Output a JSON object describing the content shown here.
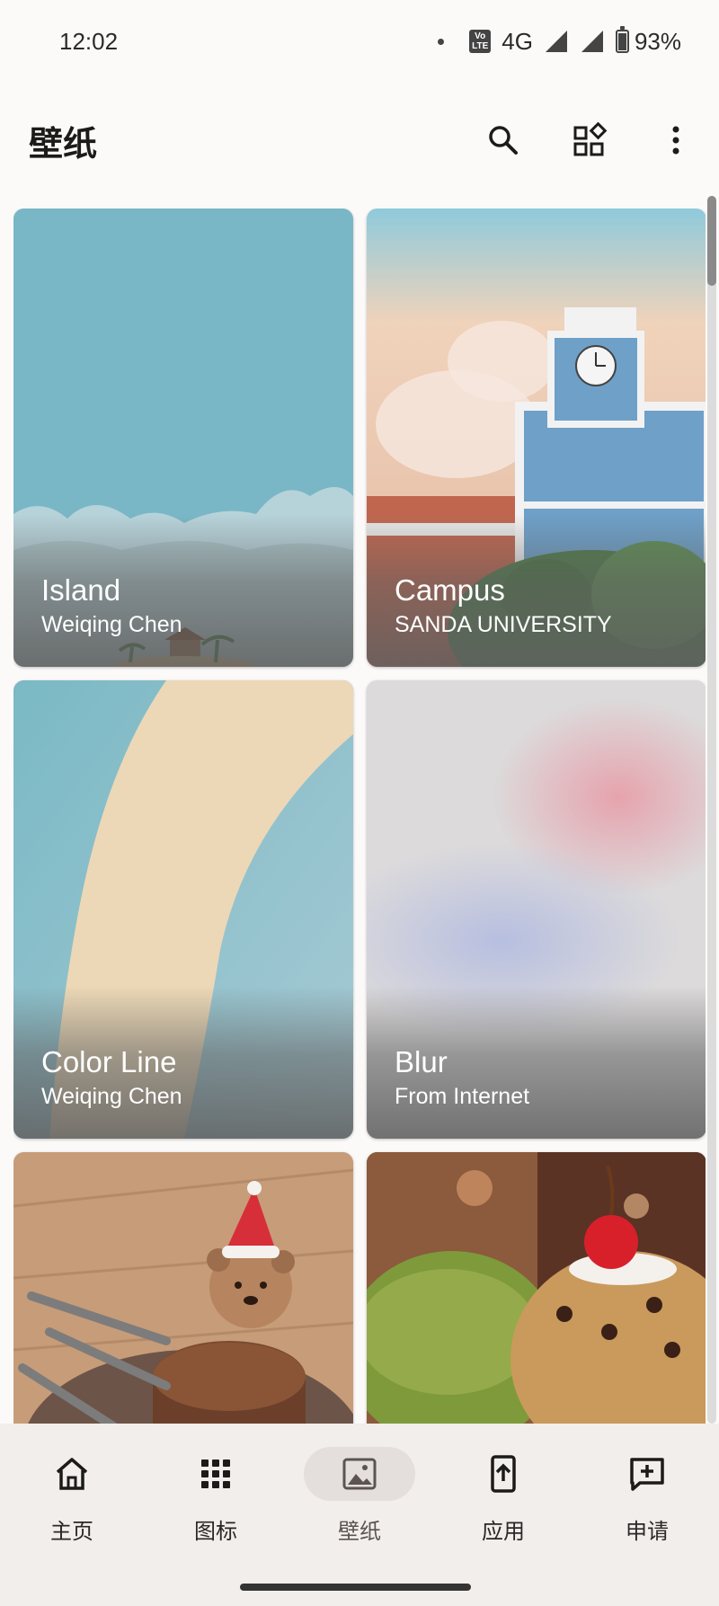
{
  "status_bar": {
    "time": "12:02",
    "network": "4G",
    "volte_top": "Vo",
    "volte_bottom": "LTE",
    "battery": "93%"
  },
  "app_bar": {
    "title": "壁纸",
    "icons": [
      "search-icon",
      "widgets-icon",
      "more-vert-icon"
    ]
  },
  "wallpapers": [
    {
      "title": "Island",
      "author": "Weiqing Chen"
    },
    {
      "title": "Campus",
      "author": "SANDA UNIVERSITY"
    },
    {
      "title": "Color Line",
      "author": "Weiqing Chen"
    },
    {
      "title": "Blur",
      "author": "From Internet"
    },
    {
      "title": "",
      "author": ""
    },
    {
      "title": "",
      "author": ""
    }
  ],
  "bottom_nav": {
    "items": [
      {
        "label": "主页",
        "icon": "home-icon"
      },
      {
        "label": "图标",
        "icon": "apps-grid-icon"
      },
      {
        "label": "壁纸",
        "icon": "image-icon",
        "active": true
      },
      {
        "label": "应用",
        "icon": "app-upload-icon"
      },
      {
        "label": "申请",
        "icon": "request-icon"
      }
    ]
  },
  "colors": {
    "background": "#fcfaf9",
    "nav_background": "#f1eeec",
    "active_pill": "#e4dfdc"
  }
}
